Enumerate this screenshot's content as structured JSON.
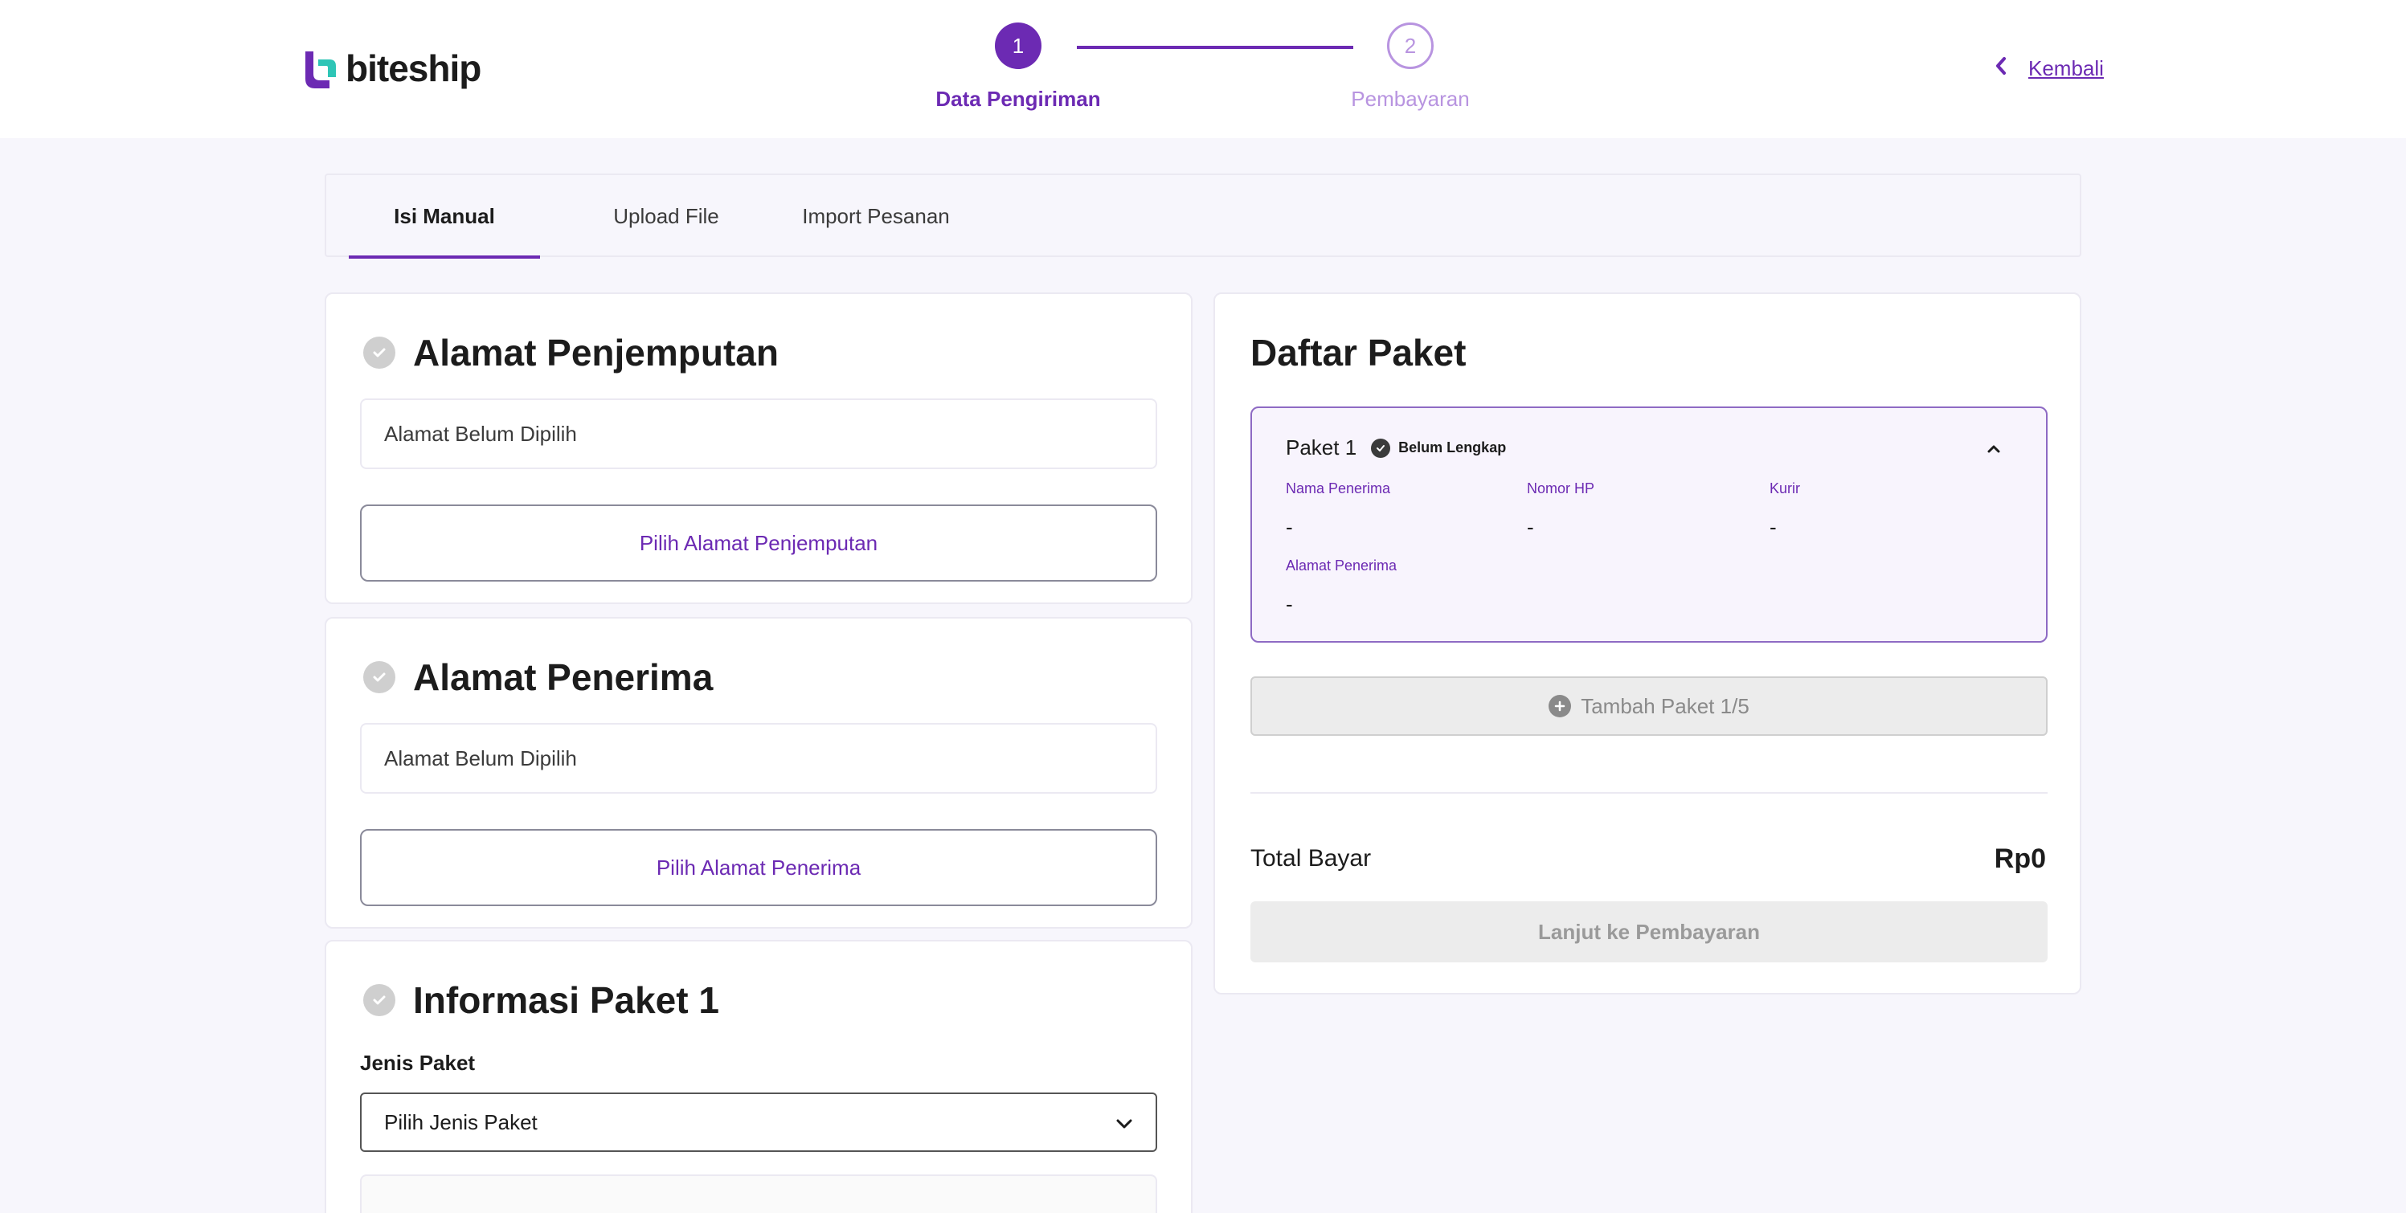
{
  "brand": {
    "name": "biteship",
    "colors": {
      "primary": "#6c2ab3",
      "primary_light": "#b894e0",
      "logo_teal": "#2ec5b6"
    }
  },
  "stepper": {
    "steps": [
      {
        "number": "1",
        "label": "Data Pengiriman",
        "state": "active"
      },
      {
        "number": "2",
        "label": "Pembayaran",
        "state": "inactive"
      }
    ]
  },
  "header": {
    "back_label": "Kembali",
    "back_icon": "chevron-left-icon"
  },
  "tabs": [
    {
      "label": "Isi Manual",
      "active": true
    },
    {
      "label": "Upload File",
      "active": false
    },
    {
      "label": "Import Pesanan",
      "active": false
    }
  ],
  "pickup": {
    "title": "Alamat Penjemputan",
    "address_value": "Alamat Belum Dipilih",
    "button_label": "Pilih Alamat Penjemputan"
  },
  "receiver": {
    "title": "Alamat Penerima",
    "address_value": "Alamat Belum Dipilih",
    "button_label": "Pilih Alamat Penerima"
  },
  "package_info": {
    "title": "Informasi Paket 1",
    "type_label": "Jenis Paket",
    "type_placeholder": "Pilih Jenis Paket"
  },
  "package_list": {
    "title": "Daftar Paket",
    "package": {
      "name": "Paket 1",
      "status": "Belum Lengkap",
      "fields": [
        {
          "label": "Nama Penerima",
          "value": "-"
        },
        {
          "label": "Nomor HP",
          "value": "-"
        },
        {
          "label": "Kurir",
          "value": "-"
        },
        {
          "label": "Alamat Penerima",
          "value": "-"
        }
      ]
    },
    "add_button_label": "Tambah Paket 1/5",
    "total_label": "Total Bayar",
    "total_value": "Rp0",
    "next_button_label": "Lanjut ke Pembayaran"
  }
}
